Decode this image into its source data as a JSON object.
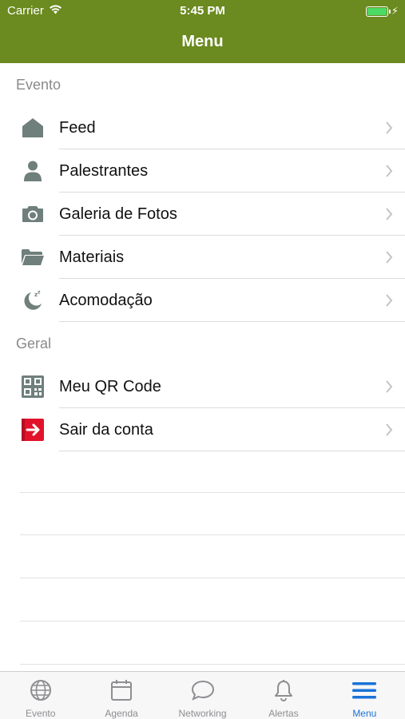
{
  "status_bar": {
    "carrier": "Carrier",
    "time": "5:45 PM",
    "battery_level": 1.0
  },
  "nav": {
    "title": "Menu"
  },
  "colors": {
    "nav_background": "#6b8a1f",
    "tab_active": "#1a73d9",
    "tab_inactive": "#8e8e93",
    "icon_gray": "#6f7f7c",
    "logout_red": "#e2122a"
  },
  "sections": [
    {
      "header": "Evento",
      "items": [
        {
          "label": "Feed",
          "icon": "home-icon"
        },
        {
          "label": "Palestrantes",
          "icon": "person-icon"
        },
        {
          "label": "Galeria de Fotos",
          "icon": "camera-icon"
        },
        {
          "label": "Materiais",
          "icon": "folder-icon"
        },
        {
          "label": "Acomodação",
          "icon": "moon-sleep-icon"
        }
      ]
    },
    {
      "header": "Geral",
      "items": [
        {
          "label": "Meu QR Code",
          "icon": "qr-code-icon"
        },
        {
          "label": "Sair da conta",
          "icon": "logout-icon"
        }
      ]
    }
  ],
  "tabs": [
    {
      "label": "Evento",
      "icon": "globe-icon",
      "active": false
    },
    {
      "label": "Agenda",
      "icon": "calendar-icon",
      "active": false
    },
    {
      "label": "Networking",
      "icon": "chat-bubble-icon",
      "active": false
    },
    {
      "label": "Alertas",
      "icon": "bell-icon",
      "active": false
    },
    {
      "label": "Menu",
      "icon": "hamburger-menu-icon",
      "active": true
    }
  ]
}
